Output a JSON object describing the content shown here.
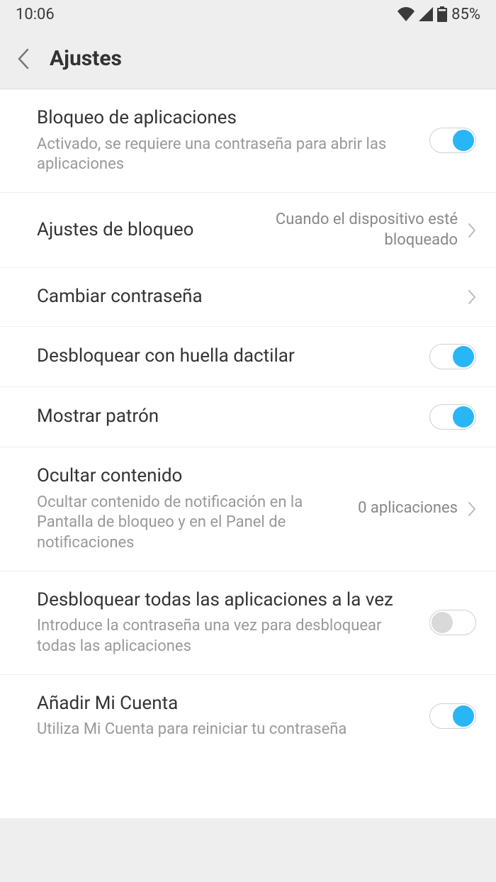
{
  "status": {
    "time": "10:06",
    "battery_pct": "85%"
  },
  "header": {
    "title": "Ajustes"
  },
  "rows": [
    {
      "title": "Bloqueo de aplicaciones",
      "sub": "Activado, se requiere una contraseña para abrir las aplicaciones",
      "type": "toggle",
      "on": true
    },
    {
      "title": "Ajustes de bloqueo",
      "value": "Cuando el dispositivo esté bloqueado",
      "type": "nav"
    },
    {
      "title": "Cambiar contraseña",
      "type": "nav"
    },
    {
      "title": "Desbloquear con huella dactilar",
      "type": "toggle",
      "on": true
    },
    {
      "title": "Mostrar patrón",
      "type": "toggle",
      "on": true
    },
    {
      "title": "Ocultar contenido",
      "sub": "Ocultar contenido de notificación en la Pantalla de bloqueo y en el Panel de notificaciones",
      "value": "0 aplicaciones",
      "type": "nav"
    },
    {
      "title": "Desbloquear todas las aplicaciones a la vez",
      "sub": "Introduce la contraseña una vez para desbloquear todas las aplicaciones",
      "type": "toggle",
      "on": false
    },
    {
      "title": "Añadir Mi Cuenta",
      "sub": "Utiliza Mi Cuenta para reiniciar tu contraseña",
      "type": "toggle",
      "on": true
    }
  ]
}
